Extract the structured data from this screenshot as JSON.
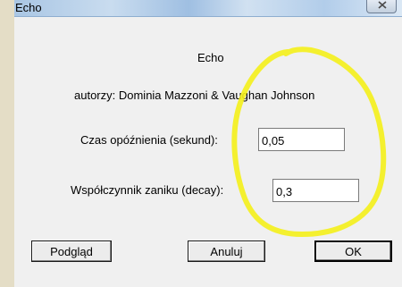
{
  "window": {
    "title": "Echo"
  },
  "dialog": {
    "heading": "Echo",
    "authors": "autorzy: Dominia Mazzoni & Vaughan Johnson",
    "delay_label": "Czas opóźnienia (sekund):",
    "delay_value": "0,05",
    "decay_label": "Współczynnik zaniku (decay):",
    "decay_value": "0,3"
  },
  "buttons": {
    "preview": "Podgląd",
    "cancel": "Anuluj",
    "ok": "OK"
  },
  "annotation": {
    "color": "#f4ef1a"
  }
}
